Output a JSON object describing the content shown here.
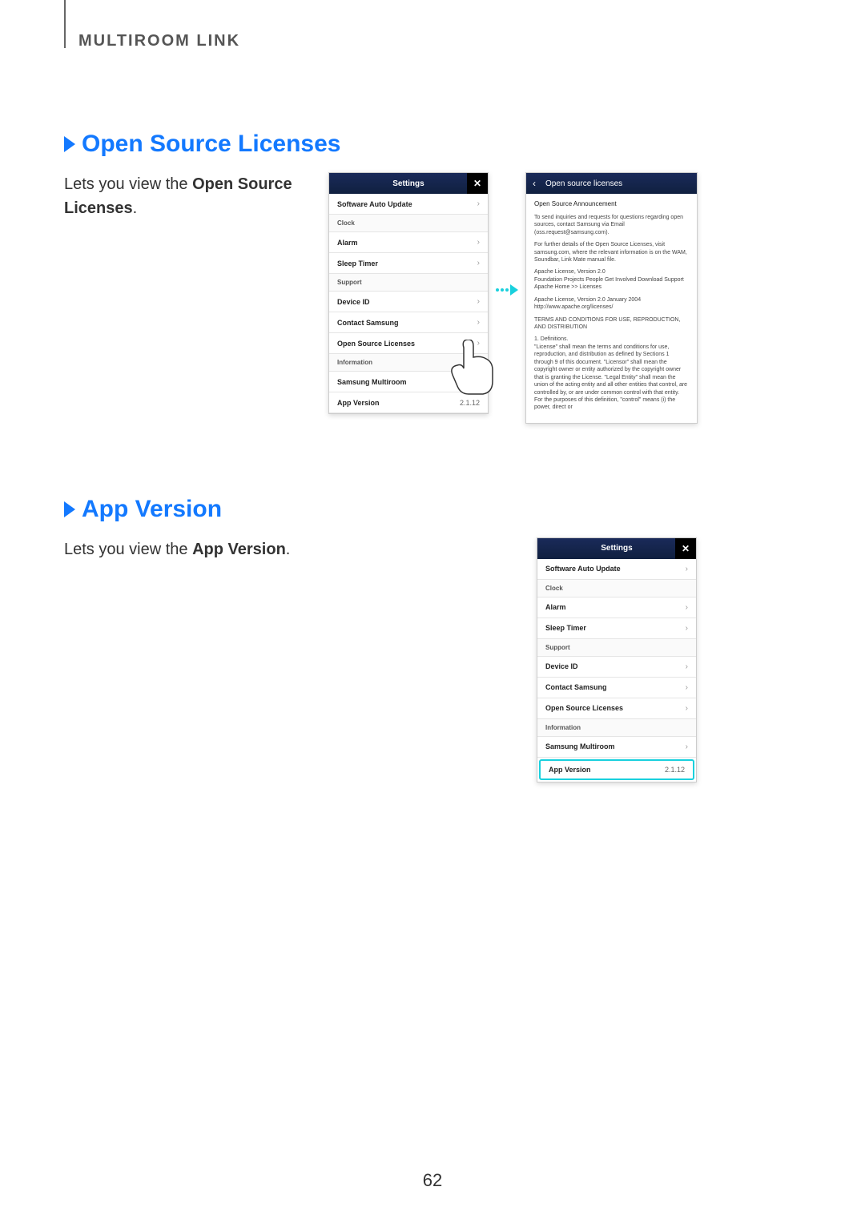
{
  "header": "MULTIROOM LINK",
  "page_number": "62",
  "section1": {
    "title": "Open Source Licenses",
    "desc_prefix": "Lets you view the ",
    "desc_bold": "Open Source Licenses",
    "desc_suffix": "."
  },
  "section2": {
    "title": "App Version",
    "desc_prefix": "Lets you view the ",
    "desc_bold": "App Version",
    "desc_suffix": "."
  },
  "settings_panel": {
    "title": "Settings",
    "rows": [
      {
        "label": "Software Auto Update",
        "chev": true
      },
      {
        "group": "Clock"
      },
      {
        "label": "Alarm",
        "chev": true
      },
      {
        "label": "Sleep Timer",
        "chev": true
      },
      {
        "group": "Support"
      },
      {
        "label": "Device ID",
        "chev": true
      },
      {
        "label": "Contact Samsung",
        "chev": true
      },
      {
        "label": "Open Source Licenses",
        "chev": true
      },
      {
        "group": "Information"
      },
      {
        "label": "Samsung Multiroom",
        "chev": true
      },
      {
        "label": "App Version",
        "value": "2.1.12"
      }
    ]
  },
  "osl_doc": {
    "title": "Open source licenses",
    "announcement": "Open Source Announcement",
    "p1": "To send inquiries and requests for questions regarding open sources, contact Samsung via Email (oss.request@samsung.com).",
    "p2": "For further details of the Open Source Licenses, visit samsung.com, where the relevant information is on the WAM, Soundbar, Link Mate manual file.",
    "p3": "Apache License, Version 2.0\nFoundation Projects People Get Involved Download Support Apache Home >> Licenses",
    "p4": "Apache License, Version 2.0 January 2004\nhttp://www.apache.org/licenses/",
    "p5": "TERMS AND CONDITIONS FOR USE, REPRODUCTION, AND DISTRIBUTION",
    "p6": "1. Definitions.\n\"License\" shall mean the terms and conditions for use, reproduction, and distribution as defined by Sections 1 through 9 of this document. \"Licensor\" shall mean the copyright owner or entity authorized by the copyright owner that is granting the License. \"Legal Entity\" shall mean the union of the acting entity and all other entities that control, are controlled by, or are under common control with that entity. For the purposes of this definition, \"control\" means (i) the power, direct or"
  }
}
